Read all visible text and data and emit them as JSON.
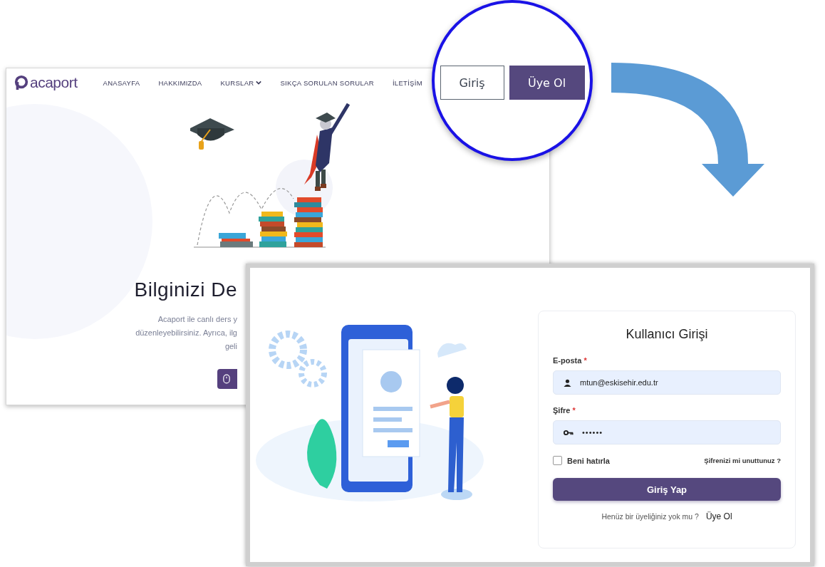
{
  "back_page": {
    "logo": "acaport",
    "nav": [
      {
        "label": "ANASAYFA",
        "has_menu": false
      },
      {
        "label": "HAKKIMIZDA",
        "has_menu": false
      },
      {
        "label": "KURSLAR",
        "has_menu": true
      },
      {
        "label": "SIKÇA SORULAN SORULAR",
        "has_menu": false
      },
      {
        "label": "İLETİŞİM",
        "has_menu": false
      }
    ],
    "hero_title": "Bilginizi De",
    "hero_text": [
      "Acaport ile canlı ders y",
      "düzenleyebilirsiniz. Ayrıca, ilg",
      "geli"
    ]
  },
  "magnifier": {
    "buttons": [
      {
        "label": "Giriş",
        "kind": "outline"
      },
      {
        "label": "Üye Ol",
        "kind": "filled"
      }
    ]
  },
  "login": {
    "title": "Kullanıcı Girişi",
    "fields": [
      {
        "kind": "email",
        "label": "E-posta",
        "required_mark": "*",
        "value": "mtun@eskisehir.edu.tr"
      },
      {
        "kind": "password",
        "label": "Şifre",
        "required_mark": "*",
        "value": "••••••"
      }
    ],
    "remember": {
      "label": "Beni hatırla",
      "checked": false
    },
    "forgot_link": "Şifrenizi mi unuttunuz ?",
    "submit": "Giriş Yap",
    "footer_text": "Henüz bir üyeliğiniz yok mu ?",
    "footer_link": "Üye Ol"
  }
}
